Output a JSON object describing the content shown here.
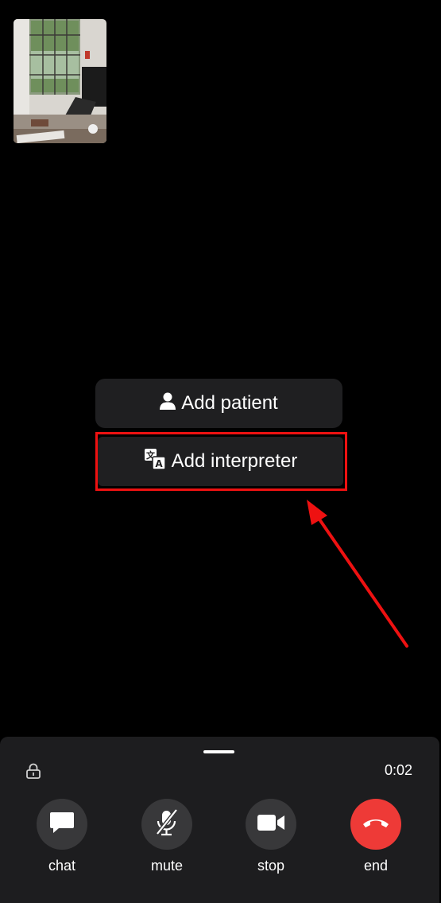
{
  "self_view": {
    "icon": "camera-self-preview"
  },
  "actions": {
    "add_patient": {
      "icon": "person-icon",
      "label": "Add patient"
    },
    "add_interpreter": {
      "icon": "translate-icon",
      "label": "Add interpreter"
    }
  },
  "annotation": {
    "highlight_color": "#ee1111"
  },
  "call_panel": {
    "timer": "0:02",
    "controls": [
      {
        "id": "chat",
        "label": "chat",
        "icon": "chat-bubble-icon"
      },
      {
        "id": "mute",
        "label": "mute",
        "icon": "microphone-off-icon"
      },
      {
        "id": "stop",
        "label": "stop",
        "icon": "video-camera-icon"
      },
      {
        "id": "end",
        "label": "end",
        "icon": "phone-hangup-icon",
        "color": "#ee3a37"
      }
    ]
  }
}
